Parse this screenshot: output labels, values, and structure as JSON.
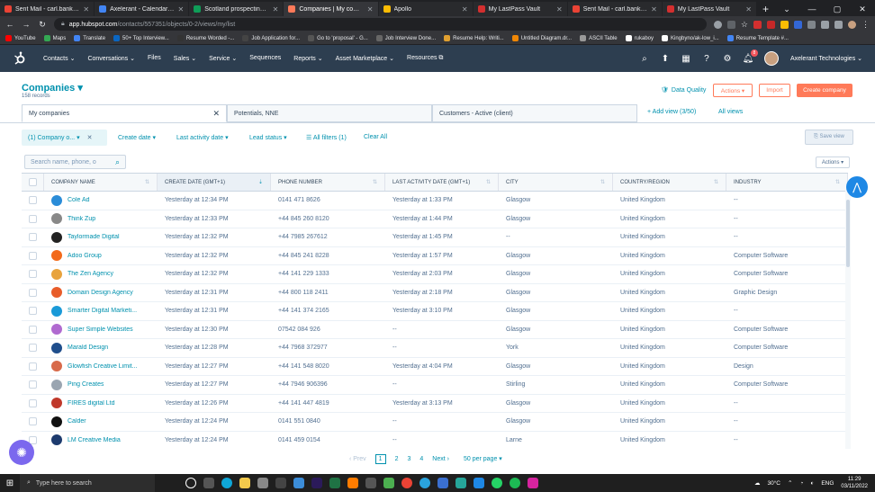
{
  "browser": {
    "tabs": [
      {
        "label": "Sent Mail - carl.banks@ax",
        "color": "#ea4335",
        "active": false
      },
      {
        "label": "Axelerant - Calendar - Nov",
        "color": "#4285f4",
        "active": false
      },
      {
        "label": "Scotland prospecting - Go",
        "color": "#0f9d58",
        "active": false
      },
      {
        "label": "Companies | My compani",
        "color": "#ff7a59",
        "active": true
      },
      {
        "label": "Apollo",
        "color": "#fbbc04",
        "active": false
      },
      {
        "label": "My LastPass Vault",
        "color": "#d32f2f",
        "active": false
      },
      {
        "label": "Sent Mail - carl.banks@ax",
        "color": "#ea4335",
        "active": false
      },
      {
        "label": "My LastPass Vault",
        "color": "#d32f2f",
        "active": false
      }
    ],
    "url_host": "app.hubspot.com",
    "url_path": "/contacts/557351/objects/0-2/views/my/list",
    "bookmarks": [
      {
        "label": "YouTube",
        "color": "#ff0000"
      },
      {
        "label": "Maps",
        "color": "#34a853"
      },
      {
        "label": "Translate",
        "color": "#4285f4"
      },
      {
        "label": "50+ Top Interview...",
        "color": "#0a66c2"
      },
      {
        "label": "Resume Worded -...",
        "color": "#333"
      },
      {
        "label": "Job Application for...",
        "color": "#444"
      },
      {
        "label": "Go to 'proposal' - G...",
        "color": "#555"
      },
      {
        "label": "Job Interview Done...",
        "color": "#666"
      },
      {
        "label": "Resume Help: Writi...",
        "color": "#e0a030"
      },
      {
        "label": "Untitled Diagram.dr...",
        "color": "#f08705"
      },
      {
        "label": "ASCII Table",
        "color": "#999"
      },
      {
        "label": "rukaboy",
        "color": "#fff"
      },
      {
        "label": "Kingbyno/ak-low_i...",
        "color": "#fff"
      },
      {
        "label": "Resume Template #...",
        "color": "#4285f4"
      }
    ]
  },
  "hubspot_nav": {
    "menu": [
      "Contacts ⌄",
      "Conversations ⌄",
      "Files",
      "Sales ⌄",
      "Service ⌄",
      "Sequences",
      "Reports ⌄",
      "Asset Marketplace ⌄",
      "Resources ⧉"
    ],
    "notification_count": "8",
    "account": "Axelerant Technologies ⌄"
  },
  "page": {
    "title": "Companies ▾",
    "subtitle": "158 records",
    "data_quality": "Data Quality",
    "actions_btn": "Actions ▾",
    "import_btn": "Import",
    "create_btn": "Create company"
  },
  "views": {
    "tabs": [
      "My companies",
      "Potentials, NNE",
      "Customers - Active (client)"
    ],
    "add_view": "+ Add view (3/50)",
    "all_views": "All views"
  },
  "filters": {
    "chip": "(1) Company o... ▾",
    "create_date": "Create date ▾",
    "last_activity": "Last activity date ▾",
    "lead_status": "Lead status ▾",
    "all_filters": "☰ All filters (1)",
    "clear_all": "Clear All",
    "save_view": "⎘ Save view"
  },
  "table": {
    "search_placeholder": "Search name, phone, o",
    "actions": "Actions ▾",
    "headers": [
      "COMPANY NAME",
      "CREATE DATE (GMT+1)",
      "PHONE NUMBER",
      "LAST ACTIVITY DATE (GMT+1)",
      "CITY",
      "COUNTRY/REGION",
      "INDUSTRY"
    ],
    "rows": [
      {
        "name": "Cole Ad",
        "logo": "#2a8cd8",
        "created": "Yesterday at 12:34 PM",
        "phone": "0141 471 8626",
        "activity": "Yesterday at 1:33 PM",
        "city": "Glasgow",
        "country": "United Kingdom",
        "industry": "--"
      },
      {
        "name": "Think Zup",
        "logo": "#888888",
        "created": "Yesterday at 12:33 PM",
        "phone": "+44 845 260 8120",
        "activity": "Yesterday at 1:44 PM",
        "city": "Glasgow",
        "country": "United Kingdom",
        "industry": "--"
      },
      {
        "name": "Taylormade Digital",
        "logo": "#222222",
        "created": "Yesterday at 12:32 PM",
        "phone": "+44 7985 267612",
        "activity": "Yesterday at 1:45 PM",
        "city": "--",
        "country": "United Kingdom",
        "industry": "--"
      },
      {
        "name": "Adoo Group",
        "logo": "#f26a1b",
        "created": "Yesterday at 12:32 PM",
        "phone": "+44 845 241 8228",
        "activity": "Yesterday at 1:57 PM",
        "city": "Glasgow",
        "country": "United Kingdom",
        "industry": "Computer Software"
      },
      {
        "name": "The Zen Agency",
        "logo": "#e8a33d",
        "created": "Yesterday at 12:32 PM",
        "phone": "+44 141 229 1333",
        "activity": "Yesterday at 2:03 PM",
        "city": "Glasgow",
        "country": "United Kingdom",
        "industry": "Computer Software"
      },
      {
        "name": "Domain Design Agency",
        "logo": "#e85d2a",
        "created": "Yesterday at 12:31 PM",
        "phone": "+44 800 118 2411",
        "activity": "Yesterday at 2:18 PM",
        "city": "Glasgow",
        "country": "United Kingdom",
        "industry": "Graphic Design"
      },
      {
        "name": "Smarter Digital Marketi...",
        "logo": "#1a9ad8",
        "created": "Yesterday at 12:31 PM",
        "phone": "+44 141 374 2165",
        "activity": "Yesterday at 3:10 PM",
        "city": "Glasgow",
        "country": "United Kingdom",
        "industry": "--"
      },
      {
        "name": "Super Simple Websites",
        "logo": "#b06ad0",
        "created": "Yesterday at 12:30 PM",
        "phone": "07542 084 926",
        "activity": "--",
        "city": "Glasgow",
        "country": "United Kingdom",
        "industry": "Computer Software"
      },
      {
        "name": "Marald Design",
        "logo": "#1f4e8c",
        "created": "Yesterday at 12:28 PM",
        "phone": "+44 7968 372977",
        "activity": "--",
        "city": "York",
        "country": "United Kingdom",
        "industry": "Computer Software"
      },
      {
        "name": "Glowfish Creative Limit...",
        "logo": "#d86a4a",
        "created": "Yesterday at 12:27 PM",
        "phone": "+44 141 548 8020",
        "activity": "Yesterday at 4:04 PM",
        "city": "Glasgow",
        "country": "United Kingdom",
        "industry": "Design"
      },
      {
        "name": "Ping Creates",
        "logo": "#9aa5b1",
        "created": "Yesterday at 12:27 PM",
        "phone": "+44 7946 906396",
        "activity": "--",
        "city": "Stirling",
        "country": "United Kingdom",
        "industry": "Computer Software"
      },
      {
        "name": "FIRES digital Ltd",
        "logo": "#c0392b",
        "created": "Yesterday at 12:26 PM",
        "phone": "+44 141 447 4819",
        "activity": "Yesterday at 3:13 PM",
        "city": "Glasgow",
        "country": "United Kingdom",
        "industry": "--"
      },
      {
        "name": "Calder",
        "logo": "#111111",
        "created": "Yesterday at 12:24 PM",
        "phone": "0141 551 0840",
        "activity": "--",
        "city": "Glasgow",
        "country": "United Kingdom",
        "industry": "--"
      },
      {
        "name": "LM Creative Media",
        "logo": "#1d3b6e",
        "created": "Yesterday at 12:24 PM",
        "phone": "0141 459 0154",
        "activity": "--",
        "city": "Larne",
        "country": "United Kingdom",
        "industry": "--"
      }
    ]
  },
  "pager": {
    "prev": "‹  Prev",
    "pages": [
      "1",
      "2",
      "3",
      "4"
    ],
    "next": "Next  ›",
    "per_page": "50 per page ▾"
  },
  "taskbar": {
    "search": "Type here to search",
    "weather": "30°C",
    "lang": "ENG",
    "time": "11:29",
    "date": "03/11/2022"
  }
}
